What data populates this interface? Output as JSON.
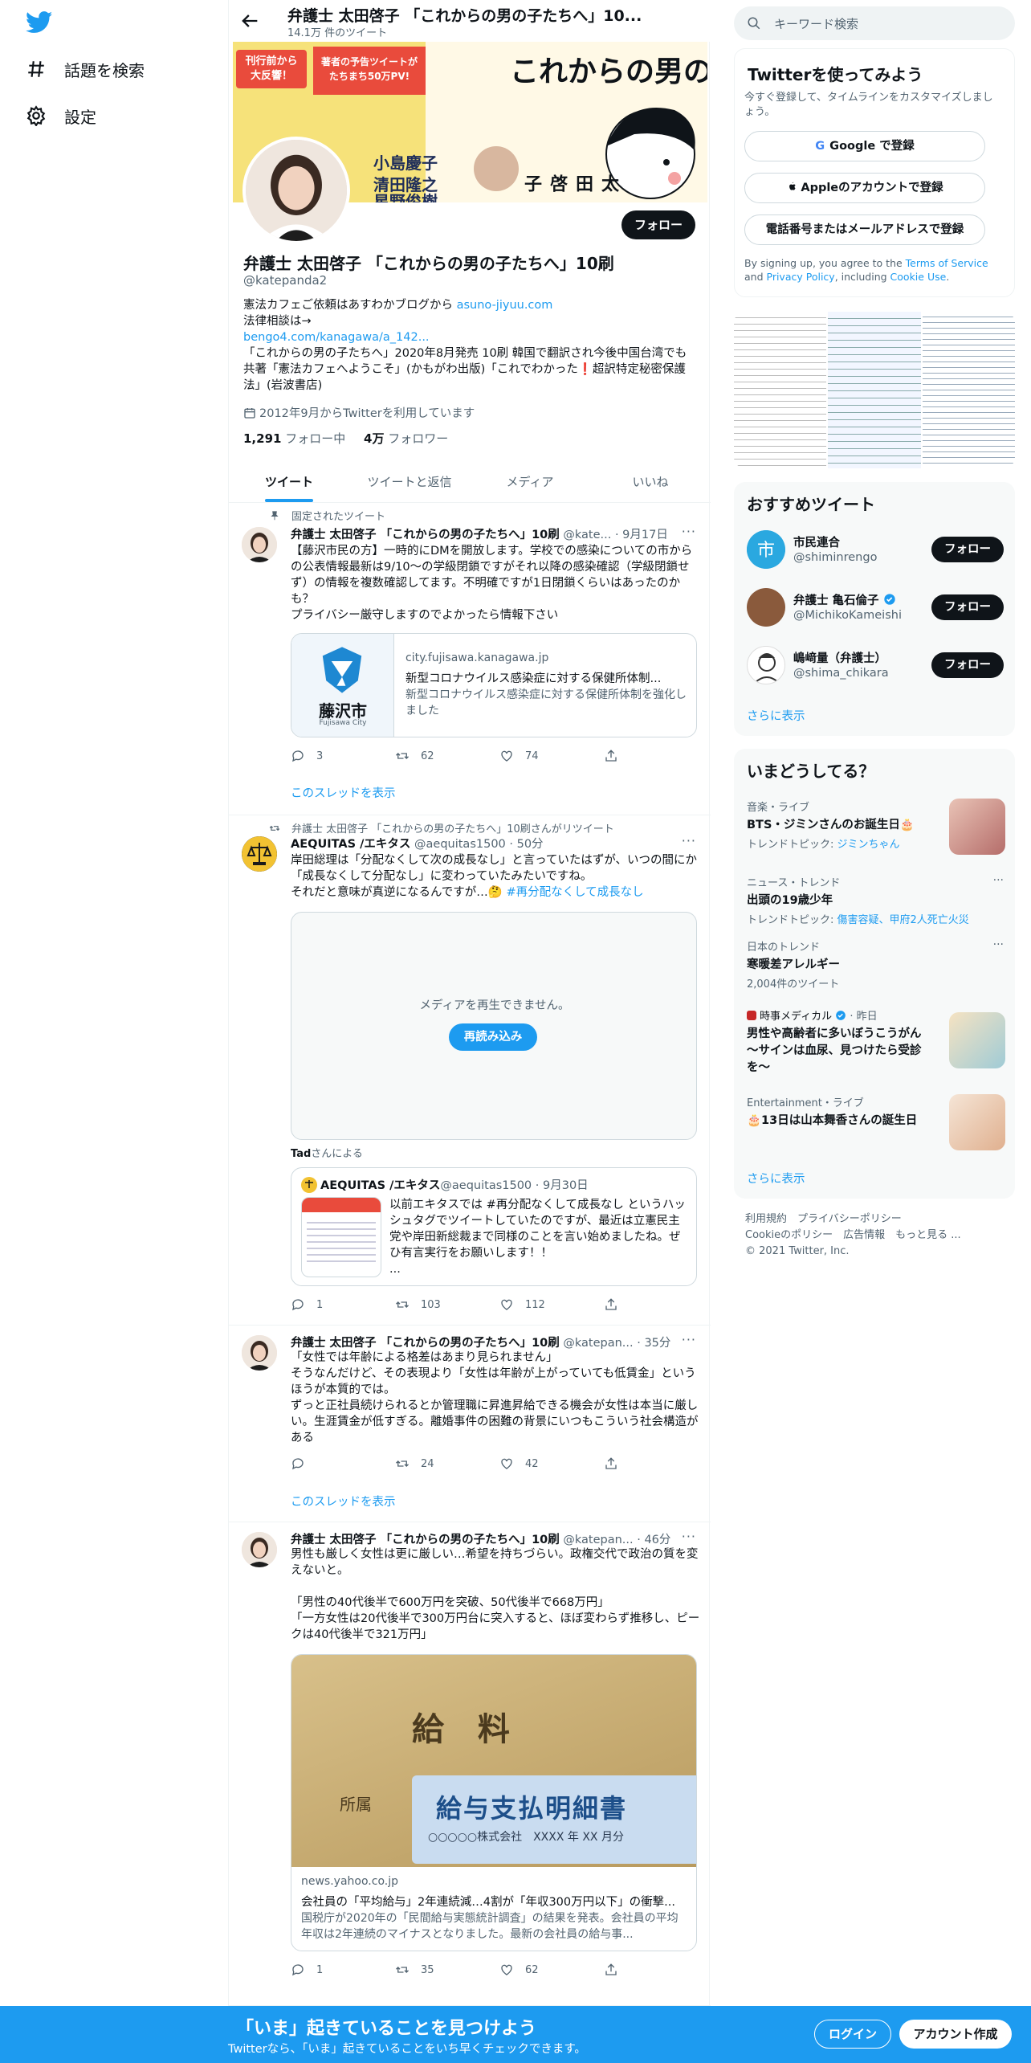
{
  "nav": {
    "explore": "話題を検索",
    "settings": "設定"
  },
  "topbar": {
    "title": "弁護士 太田啓子 「これからの男の子たちへ」10...",
    "subtitle": "14.1万 件のツイート"
  },
  "banner": {
    "book_title": "これからの男の子たちへ",
    "badge1": "刊行前から\n大反響！",
    "badge2": "著者の予告ツイートが\nたちまち50万PV!",
    "author_tag": "太田啓子",
    "guest1": "小島慶子",
    "guest2": "清田隆之",
    "guest3": "星野俊樹"
  },
  "profile": {
    "follow": "フォロー",
    "name": "弁護士 太田啓子 「これからの男の子たちへ」10刷",
    "handle": "@katepanda2",
    "bio_line1": "憲法カフェご依頼はあすわかブログから ",
    "bio_link1": "asuno-jiyuu.com",
    "bio_line2": "法律相談は→",
    "bio_link2": "bengo4.com/kanagawa/a_142...",
    "bio_line3": "「これからの男の子たちへ」2020年8月発売 10刷 韓国で翻訳され今後中国台湾でも",
    "bio_line4": "共著「憲法カフェへようこそ」(かもがわ出版)「これでわかった❗超訳特定秘密保護法」(岩波書店)",
    "joined": "2012年9月からTwitterを利用しています",
    "following_count": "1,291",
    "following_label": " フォロー中",
    "followers_count": "4万",
    "followers_label": " フォロワー"
  },
  "tabs": [
    "ツイート",
    "ツイートと返信",
    "メディア",
    "いいね"
  ],
  "tweets": [
    {
      "context": "固定されたツイート",
      "name": "弁護士 太田啓子 「これからの男の子たちへ」10刷",
      "meta": " @kate... · 9月17日",
      "text": "【藤沢市民の方】一時的にDMを開放します。学校での感染についての市からの公表情報最新は9/10～の学級閉鎖ですがそれ以降の感染確認（学級閉鎖せず）の情報を複数確認してます。不明確ですが1日閉鎖くらいはあったのかも？\nプライバシー厳守しますのでよかったら情報下さい",
      "card": {
        "domain": "city.fujisawa.kanagawa.jp",
        "title": "新型コロナウイルス感染症に対する保健所体制...",
        "desc": "新型コロナウイルス感染症に対する保健所体制を強化しました",
        "logo_text": "藤沢市",
        "logo_sub": "Fujisawa City"
      },
      "replies": "3",
      "retweets": "62",
      "likes": "74",
      "thread": "このスレッドを表示"
    },
    {
      "context": "弁護士 太田啓子 「これからの男の子たちへ」10刷さんがリツイート",
      "name": "AEQUITAS /エキタス",
      "meta": " @aequitas1500 · 50分",
      "text": "岸田総理は「分配なくして次の成長なし」と言っていたはずが、いつの間にか「成長なくして分配なし」に変わっていたみたいですね。\nそれだと意味が真逆になるんですが…🤔 ",
      "hashtag": "#再分配なくして成長なし",
      "media_error": "メディアを再生できません。",
      "reload": "再読み込み",
      "credit_name": "Tad",
      "credit_suffix": "さんによる",
      "quote": {
        "name": "AEQUITAS /エキタス",
        "meta": " @aequitas1500 · 9月30日",
        "text": "以前エキタスでは #再分配なくして成長なし というハッシュタグでツイートしていたのですが、最近は立憲民主党や岸田新総裁まで同様のことを言い始めましたね。ぜひ有言実行をお願いします！！\n..."
      },
      "replies": "1",
      "retweets": "103",
      "likes": "112"
    },
    {
      "name": "弁護士 太田啓子 「これからの男の子たちへ」10刷",
      "meta": " @katepan... · 35分",
      "text": "「女性では年齢による格差はあまり見られません」\nそうなんだけど、その表現より「女性は年齢が上がっていても低賃金」というほうが本質的では。\nずっと正社員続けられるとか管理職に昇進昇給できる機会が女性は本当に厳しい。生涯賃金が低すぎる。離婚事件の困難の背景にいつもこういう社会構造がある",
      "replies": "",
      "retweets": "24",
      "likes": "42",
      "thread": "このスレッドを表示"
    },
    {
      "name": "弁護士 太田啓子 「これからの男の子たちへ」10刷",
      "meta": " @katepan... · 46分",
      "text": "男性も厳しく女性は更に厳しい…希望を持ちづらい。政権交代で政治の質を変えないと。\n\n「男性の40代後半で600万円を突破、50代後半で668万円」\n「一方女性は20代後半で300万円台に突入すると、ほぼ変わらず推移し、ピークは40代後半で321万円」",
      "card": {
        "domain": "news.yahoo.co.jp",
        "title": "会社員の「平均給与」2年連続減…4割が「年収300万円以下」の衝撃...",
        "desc": "国税庁が2020年の「民間給与実態統計調査」の結果を発表。会社員の平均年収は2年連続のマイナスとなりました。最新の会社員の給与事...",
        "img_text1": "給 料",
        "img_text2": "給与支払明細書",
        "img_text3": "○○○○○株式会社　XXXX 年 XX 月分",
        "img_text4": "所属"
      },
      "replies": "1",
      "retweets": "35",
      "likes": "62"
    }
  ],
  "right": {
    "search_placeholder": "キーワード検索",
    "signup": {
      "title": "Twitterを使ってみよう",
      "subtitle": "今すぐ登録して、タイムラインをカスタマイズしましょう。",
      "google": "Google で登録",
      "apple": "Appleのアカウントで登録",
      "phone": "電話番号またはメールアドレスで登録",
      "terms_pre": "By signing up, you agree to the ",
      "terms": "Terms of Service",
      "and": " and ",
      "privacy": "Privacy Policy",
      "including": ", including ",
      "cookie": "Cookie Use",
      "period": "."
    },
    "recommended": {
      "title": "おすすめツイート",
      "follow": "フォロー",
      "users": [
        {
          "name": "市民連合",
          "handle": "@shiminrengo"
        },
        {
          "name": "弁護士 亀石倫子",
          "handle": "@MichikoKameishi"
        },
        {
          "name": "嶋﨑量（弁護士）",
          "handle": "@shima_chikara"
        }
      ],
      "more": "さらに表示"
    },
    "trends": {
      "title": "いまどうしてる？",
      "items": [
        {
          "cat": "音楽・ライブ",
          "title": "BTS・ジミンさんのお誕生日🎂",
          "sub_pre": "トレンドトピック: ",
          "sub_link": "ジミンちゃん"
        },
        {
          "cat": "ニュース・トレンド",
          "title": "出頭の19歳少年",
          "sub_pre": "トレンドトピック: ",
          "sub_link": "傷害容疑、甲府2人死亡火災"
        },
        {
          "cat": "日本のトレンド",
          "title": "寒暖差アレルギー",
          "sub": "2,004件のツイート"
        },
        {
          "cat": "時事メディカル",
          "cat_meta": " · 昨日",
          "title": "男性や高齢者に多いぼうこうがん～サインは血尿、見つけたら受診を～"
        },
        {
          "cat": "Entertainment・ライブ",
          "title": "🎂13日は山本舞香さんの誕生日"
        }
      ],
      "more": "さらに表示"
    },
    "footer": {
      "l1": "利用規約　プライバシーポリシー",
      "l2": "Cookieのポリシー　広告情報　もっと見る ...",
      "l3": "© 2021 Twitter, Inc."
    }
  },
  "bottom": {
    "title": "「いま」起きていることを見つけよう",
    "subtitle": "Twitterなら、「いま」起きていることをいち早くチェックできます。",
    "login": "ログイン",
    "signup": "アカウント作成"
  },
  "colors": {
    "accent": "#1d9bf0",
    "text": "#0f1419",
    "muted": "#536471"
  }
}
